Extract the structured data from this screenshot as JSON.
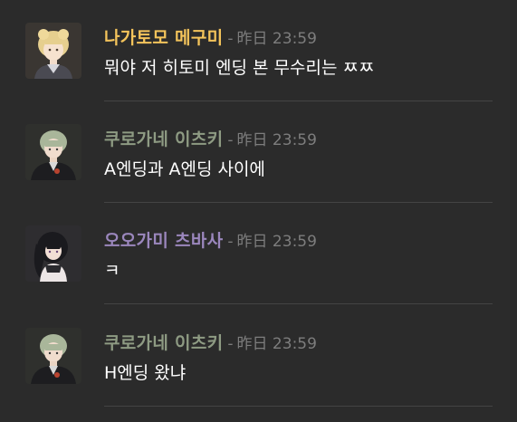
{
  "messages": [
    {
      "author": "나가토모 메구미",
      "author_color": "#f4c45b",
      "separator": "-",
      "time": "昨日 23:59",
      "text": "뭐야 저 히토미 엔딩 본 무수리는 ㅉㅉ",
      "avatar_icon": "blonde-girl-avatar"
    },
    {
      "author": "쿠로가네 이츠키",
      "author_color": "#8e9b83",
      "separator": "-",
      "time": "昨日 23:59",
      "text": "A엔딩과 A엔딩 사이에",
      "avatar_icon": "green-hair-man-avatar"
    },
    {
      "author": "오오가미 츠바사",
      "author_color": "#9b87bd",
      "separator": "-",
      "time": "昨日 23:59",
      "text": "ㅋ",
      "avatar_icon": "dark-hair-girl-avatar"
    },
    {
      "author": "쿠로가네 이츠키",
      "author_color": "#8e9b83",
      "separator": "-",
      "time": "昨日 23:59",
      "text": "H엔딩 왔냐",
      "avatar_icon": "green-hair-man-avatar"
    }
  ]
}
